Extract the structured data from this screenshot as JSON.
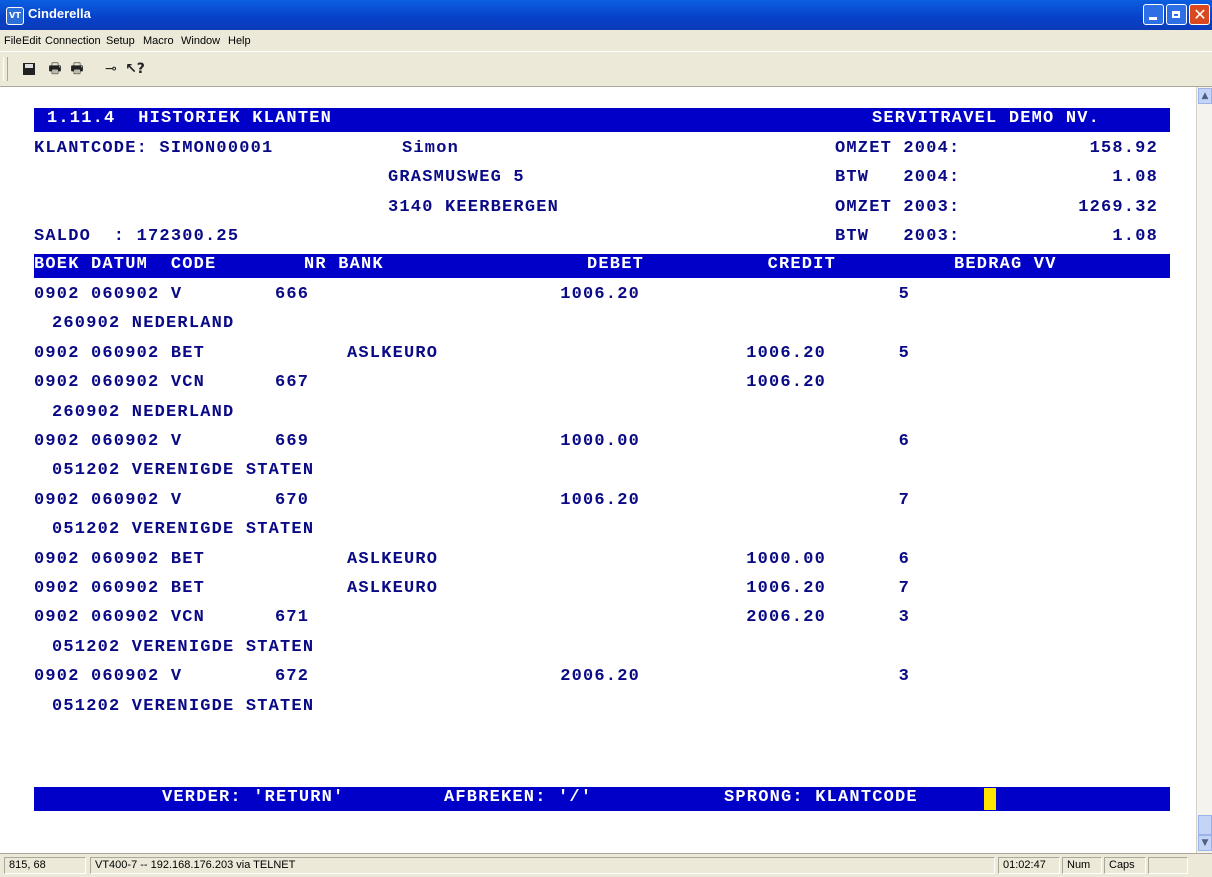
{
  "window": {
    "title": "Cinderella",
    "app_icon": "VT"
  },
  "menu": [
    "File",
    "Edit",
    "Connection",
    "Setup",
    "Macro",
    "Window",
    "Help"
  ],
  "toolbar": {
    "icons": [
      "save-icon",
      "print-icon",
      "print-setup-icon",
      "connect-icon",
      "help-pointer-icon"
    ]
  },
  "screen": {
    "header_left": "1.11.4  HISTORIEK KLANTEN",
    "header_right": "SERVITRAVEL DEMO NV.",
    "klantcode_label": "KLANTCODE: SIMON00001",
    "name": "Simon",
    "street": "GRASMUSWEG 5",
    "city": "3140 KEERBERGEN",
    "saldo": "SALDO  : 172300.25",
    "stats": [
      {
        "label": "OMZET 2004:",
        "value": "158.92"
      },
      {
        "label": "BTW   2004:",
        "value": "1.08"
      },
      {
        "label": "OMZET 2003:",
        "value": "1269.32"
      },
      {
        "label": "BTW   2003:",
        "value": "1.08"
      }
    ],
    "columns": {
      "boek_datum_code": "BOEK DATUM  CODE",
      "nr_bank": "NR BANK",
      "debet": "DEBET",
      "credit": "CREDIT",
      "bedrag_vv": "BEDRAG VV"
    },
    "rows": [
      {
        "main": "0902 060902 V",
        "nr": "666",
        "bank": "",
        "debet": "1006.20",
        "credit": "",
        "ref": "5"
      },
      {
        "sub": "260902 NEDERLAND"
      },
      {
        "main": "0902 060902 BET",
        "nr": "",
        "bank": "ASLKEURO",
        "debet": "",
        "credit": "1006.20",
        "ref": "5"
      },
      {
        "main": "0902 060902 VCN",
        "nr": "667",
        "bank": "",
        "debet": "",
        "credit": "1006.20",
        "ref": ""
      },
      {
        "sub": "260902 NEDERLAND"
      },
      {
        "main": "0902 060902 V",
        "nr": "669",
        "bank": "",
        "debet": "1000.00",
        "credit": "",
        "ref": "6"
      },
      {
        "sub": "051202 VERENIGDE STATEN"
      },
      {
        "main": "0902 060902 V",
        "nr": "670",
        "bank": "",
        "debet": "1006.20",
        "credit": "",
        "ref": "7"
      },
      {
        "sub": "051202 VERENIGDE STATEN"
      },
      {
        "main": "0902 060902 BET",
        "nr": "",
        "bank": "ASLKEURO",
        "debet": "",
        "credit": "1000.00",
        "ref": "6"
      },
      {
        "main": "0902 060902 BET",
        "nr": "",
        "bank": "ASLKEURO",
        "debet": "",
        "credit": "1006.20",
        "ref": "7"
      },
      {
        "main": "0902 060902 VCN",
        "nr": "671",
        "bank": "",
        "debet": "",
        "credit": "2006.20",
        "ref": "3"
      },
      {
        "sub": "051202 VERENIGDE STATEN"
      },
      {
        "main": "0902 060902 V",
        "nr": "672",
        "bank": "",
        "debet": "2006.20",
        "credit": "",
        "ref": "3"
      },
      {
        "sub": "051202 VERENIGDE STATEN"
      }
    ],
    "footer": {
      "verder": "VERDER: 'RETURN'",
      "afbreken": "AFBREKEN: '/'",
      "sprong": "SPRONG: KLANTCODE"
    }
  },
  "status": {
    "cursor_pos": "815, 68",
    "connection": "VT400-7 -- 192.168.176.203 via TELNET",
    "clock": "01:02:47",
    "num": "Num",
    "caps": "Caps"
  },
  "colors": {
    "terminal_text": "#0a0a86",
    "bar_bg": "#0000c8",
    "bar_text": "#ffffff",
    "cursor": "#ffe400"
  }
}
